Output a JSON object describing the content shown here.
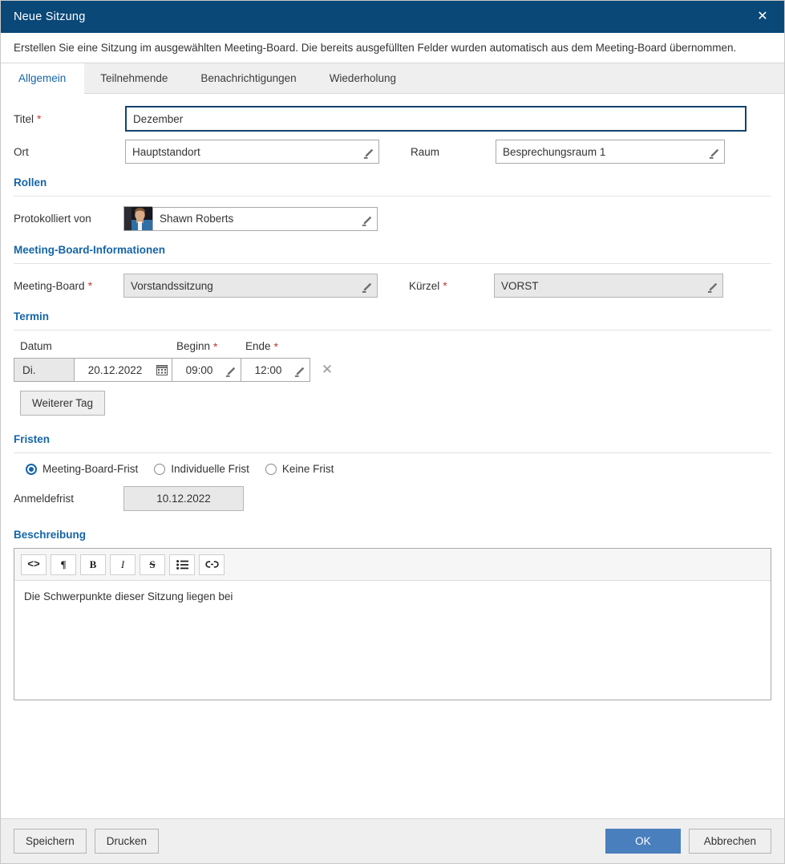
{
  "titlebar": {
    "title": "Neue Sitzung",
    "close_icon": "close-icon"
  },
  "info": {
    "text": "Erstellen Sie eine Sitzung im ausgewählten Meeting-Board. Die bereits ausgefüllten Felder wurden automatisch aus dem Meeting-Board übernommen."
  },
  "tabs": [
    {
      "label": "Allgemein",
      "active": true
    },
    {
      "label": "Teilnehmende",
      "active": false
    },
    {
      "label": "Benachrichtigungen",
      "active": false
    },
    {
      "label": "Wiederholung",
      "active": false
    }
  ],
  "general": {
    "titel": {
      "label": "Titel",
      "required": "*",
      "value": "Dezember"
    },
    "ort": {
      "label": "Ort",
      "value": "Hauptstandort"
    },
    "raum": {
      "label": "Raum",
      "value": "Besprechungsraum 1"
    }
  },
  "rollen": {
    "heading": "Rollen",
    "protokolliert": {
      "label": "Protokolliert von",
      "value": "Shawn Roberts"
    }
  },
  "board": {
    "heading": "Meeting-Board-Informationen",
    "meeting_board": {
      "label": "Meeting-Board",
      "required": "*",
      "value": "Vorstandssitzung"
    },
    "kuerzel": {
      "label": "Kürzel",
      "required": "*",
      "value": "VORST"
    }
  },
  "termin": {
    "heading": "Termin",
    "col_datum": "Datum",
    "col_beginn": "Beginn",
    "col_beginn_req": "*",
    "col_ende": "Ende",
    "col_ende_req": "*",
    "rows": [
      {
        "weekday": "Di.",
        "date": "20.12.2022",
        "start": "09:00",
        "end": "12:00"
      }
    ],
    "add_day_button": "Weiterer Tag"
  },
  "fristen": {
    "heading": "Fristen",
    "options": [
      {
        "label": "Meeting-Board-Frist",
        "selected": true
      },
      {
        "label": "Individuelle Frist",
        "selected": false
      },
      {
        "label": "Keine Frist",
        "selected": false
      }
    ],
    "anmeldefrist": {
      "label": "Anmeldefrist",
      "value": "10.12.2022"
    }
  },
  "beschreibung": {
    "heading": "Beschreibung",
    "toolbar": [
      {
        "name": "source-code-icon",
        "glyph": "<>"
      },
      {
        "name": "paragraph-icon",
        "glyph": "¶"
      },
      {
        "name": "bold-icon",
        "glyph": "B"
      },
      {
        "name": "italic-icon",
        "glyph": "I"
      },
      {
        "name": "strikethrough-icon",
        "glyph": "S"
      },
      {
        "name": "bullet-list-icon",
        "glyph": "☰"
      },
      {
        "name": "link-icon",
        "glyph": "🔗"
      }
    ],
    "content": "Die Schwerpunkte dieser Sitzung liegen bei"
  },
  "footer": {
    "save": "Speichern",
    "print": "Drucken",
    "ok": "OK",
    "cancel": "Abbrechen"
  },
  "colors": {
    "titlebar_bg": "#0a4878",
    "accent_blue": "#1565a8",
    "primary_button": "#4a7fbd",
    "required_star": "#c0392b"
  }
}
